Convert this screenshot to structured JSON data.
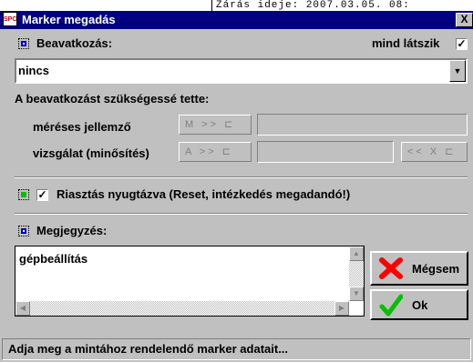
{
  "background_text": "Zárás ideje: 2007.03.05. 08:",
  "window": {
    "title": "Marker megadás",
    "app_icon_text": "SPC",
    "close_label": "X"
  },
  "intervention": {
    "label": "Beavatkozás:",
    "show_all_label": "mind látszik",
    "show_all_checked": true,
    "selected_value": "nincs"
  },
  "required_by": {
    "heading": "A beavatkozást szükségessé tette:",
    "measured": {
      "label": "méréses jellemző",
      "tools": "M >> ⊏"
    },
    "inspection": {
      "label": "vizsgálat (minősítés)",
      "tools": "A >> ⊏",
      "extra_tools": "<< X ⊏"
    }
  },
  "alarm": {
    "checked": true,
    "label": "Riasztás nyugtázva (Reset, intézkedés megadandó!)"
  },
  "note": {
    "label": "Megjegyzés:",
    "value": "gépbeállítás"
  },
  "buttons": {
    "cancel": "Mégsem",
    "ok": "Ok"
  },
  "status_bar": {
    "text": "Adja meg a mintához rendelendő marker adatait..."
  },
  "colors": {
    "title_bar": "#000080",
    "cancel_icon": "#ff0000",
    "ok_icon": "#00c000"
  }
}
